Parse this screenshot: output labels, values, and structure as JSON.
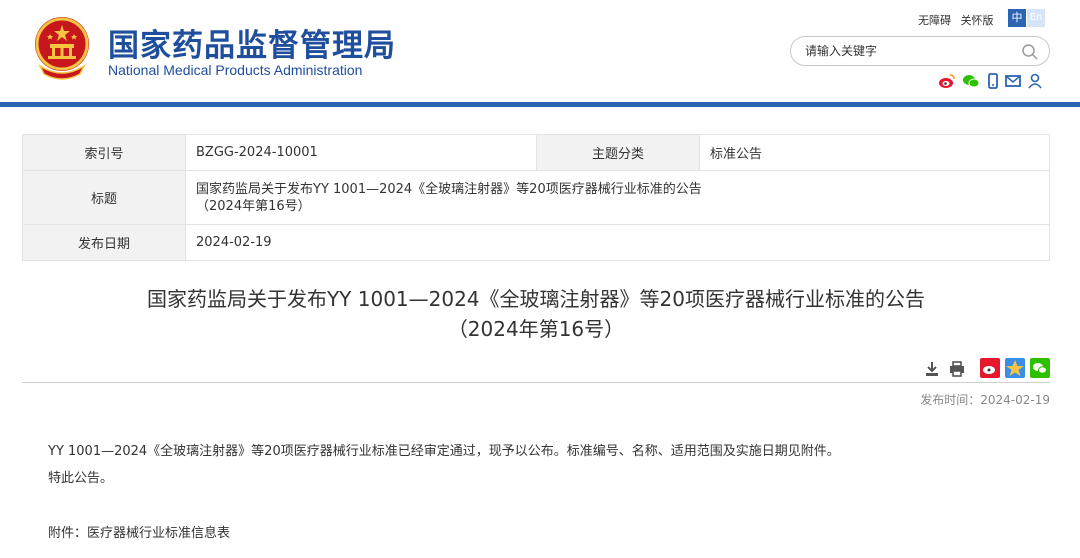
{
  "header": {
    "title_cn": "国家药品监督管理局",
    "title_en": "National Medical Products Administration",
    "links": {
      "accessibility": "无障碍",
      "care_mode": "关怀版"
    },
    "lang": {
      "zh": "中",
      "en": "En"
    },
    "search": {
      "placeholder": "请输入关键字"
    },
    "icons": [
      "weibo-icon",
      "wechat-icon",
      "mobile-icon",
      "mail-icon",
      "user-icon"
    ]
  },
  "info_table": {
    "index_label": "索引号",
    "index_value": "BZGG-2024-10001",
    "category_label": "主题分类",
    "category_value": "标准公告",
    "title_label": "标题",
    "title_value_line1": "国家药监局关于发布YY 1001—2024《全玻璃注射器》等20项医疗器械行业标准的公告",
    "title_value_line2": "（2024年第16号）",
    "date_label": "发布日期",
    "date_value": "2024-02-19"
  },
  "article": {
    "title_line1": "国家药监局关于发布YY 1001—2024《全玻璃注射器》等20项医疗器械行业标准的公告",
    "title_line2": "（2024年第16号）",
    "publish_time": "发布时间：2024-02-19",
    "paragraph1": "YY 1001—2024《全玻璃注射器》等20项医疗器械行业标准已经审定通过，现予以公布。标准编号、名称、适用范围及实施日期见附件。",
    "paragraph2": "特此公告。",
    "attachment": "附件：医疗器械行业标准信息表"
  },
  "colors": {
    "brand_blue": "#2a64b2",
    "title_blue": "#1f4e9c",
    "weibo_red": "#e6162d",
    "wechat_green": "#2dc100"
  }
}
